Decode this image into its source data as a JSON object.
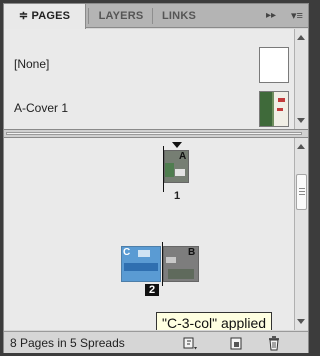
{
  "tabs": [
    {
      "label": "≑ PAGES",
      "active": true
    },
    {
      "label": "LAYERS",
      "active": false
    },
    {
      "label": "LINKS",
      "active": false
    }
  ],
  "tab_more": "▸▸",
  "panel_menu": "▾≡",
  "masters": [
    {
      "label": "[None]",
      "thumb": "blank"
    },
    {
      "label": "A-Cover 1",
      "thumb": "artwork"
    }
  ],
  "pages": [
    {
      "number": "1",
      "prefix": "A"
    },
    {
      "number": "2",
      "prefix_left": "C",
      "prefix_right": "B"
    }
  ],
  "tooltip": "\"C-3-col\" applied",
  "footer": {
    "status": "8 Pages in 5 Spreads",
    "icons": [
      "edit-page-size-icon",
      "new-page-icon",
      "trash-icon"
    ]
  },
  "colors": {
    "panel_bg": "#eaeaea",
    "tab_active": "#e9e9e9",
    "tooltip_bg": "#ffffe1",
    "selected_page": "#5a9bd3"
  }
}
